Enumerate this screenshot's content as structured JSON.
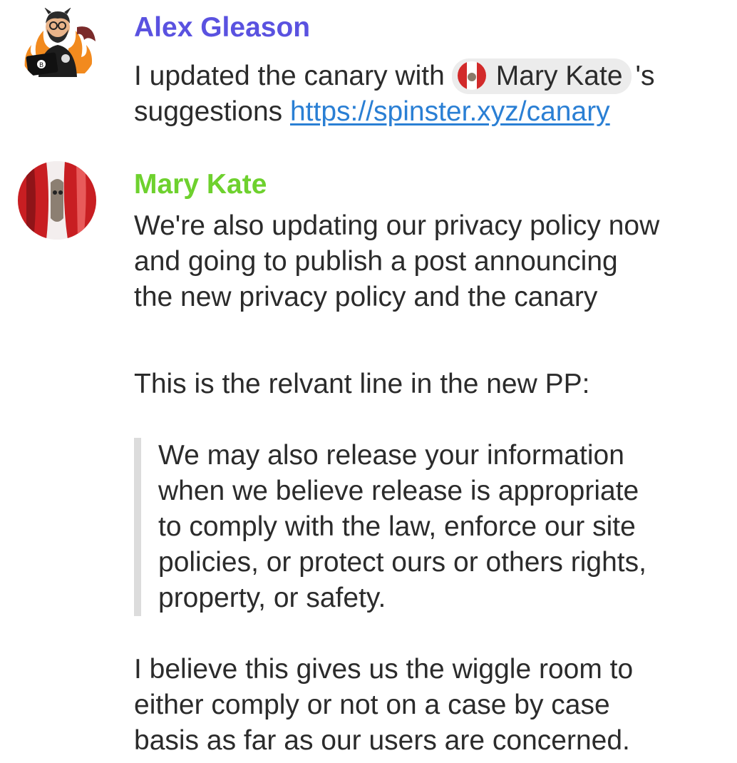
{
  "messages": [
    {
      "sender": "Alex Gleason",
      "sender_color": "#5a52e0",
      "avatar_icon": "developer-devil-avatar-icon",
      "text_before_mention": "I updated the canary with",
      "mention": "Mary Kate",
      "text_after_mention": "'s",
      "line2_prefix": "suggestions",
      "link": "https://spinster.xyz/canary"
    },
    {
      "sender": "Mary Kate",
      "sender_color": "#6ed12e",
      "avatar_icon": "red-curtain-cat-avatar-icon",
      "paragraph1": [
        "We're also updating our privacy policy now",
        "and going to publish a post announcing",
        "the new privacy policy and the canary"
      ],
      "paragraph2": "This is the relvant line in the new PP:",
      "quote": [
        "We may also release your information",
        "when we believe release is appropriate",
        "to comply with the law, enforce our site",
        "policies, or protect ours or others rights,",
        "property, or safety."
      ],
      "paragraph3": [
        "I believe this gives us the wiggle room to",
        "either comply or not on a case by case",
        "basis as far as our users are concerned."
      ]
    }
  ]
}
